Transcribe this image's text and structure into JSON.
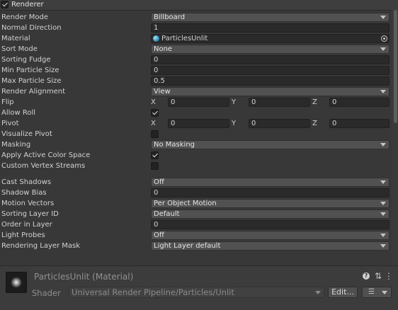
{
  "header": {
    "title": "Renderer",
    "enabled": true
  },
  "rows": {
    "render_mode": {
      "label": "Render Mode",
      "value": "Billboard"
    },
    "normal_direction": {
      "label": "Normal Direction",
      "value": "1"
    },
    "material": {
      "label": "Material",
      "value": "ParticlesUnlit"
    },
    "sort_mode": {
      "label": "Sort Mode",
      "value": "None"
    },
    "sorting_fudge": {
      "label": "Sorting Fudge",
      "value": "0"
    },
    "min_particle_size": {
      "label": "Min Particle Size",
      "value": "0"
    },
    "max_particle_size": {
      "label": "Max Particle Size",
      "value": "0.5"
    },
    "render_alignment": {
      "label": "Render Alignment",
      "value": "View"
    },
    "flip": {
      "label": "Flip",
      "x_label": "X",
      "x": "0",
      "y_label": "Y",
      "y": "0",
      "z_label": "Z",
      "z": "0"
    },
    "allow_roll": {
      "label": "Allow Roll",
      "checked": true
    },
    "pivot": {
      "label": "Pivot",
      "x_label": "X",
      "x": "0",
      "y_label": "Y",
      "y": "0",
      "z_label": "Z",
      "z": "0"
    },
    "visualize_pivot": {
      "label": "Visualize Pivot",
      "checked": false
    },
    "masking": {
      "label": "Masking",
      "value": "No Masking"
    },
    "apply_active_color_space": {
      "label": "Apply Active Color Space",
      "checked": true
    },
    "custom_vertex_streams": {
      "label": "Custom Vertex Streams",
      "checked": false
    },
    "cast_shadows": {
      "label": "Cast Shadows",
      "value": "Off"
    },
    "shadow_bias": {
      "label": "Shadow Bias",
      "value": "0"
    },
    "motion_vectors": {
      "label": "Motion Vectors",
      "value": "Per Object Motion"
    },
    "sorting_layer_id": {
      "label": "Sorting Layer ID",
      "value": "Default"
    },
    "order_in_layer": {
      "label": "Order in Layer",
      "value": "0"
    },
    "light_probes": {
      "label": "Light Probes",
      "value": "Off"
    },
    "rendering_layer_mask": {
      "label": "Rendering Layer Mask",
      "value": "Light Layer default"
    }
  },
  "material_panel": {
    "title": "ParticlesUnlit (Material)",
    "shader_label": "Shader",
    "shader_value": "Universal Render Pipeline/Particles/Unlit",
    "edit_label": "Edit...",
    "help_icon": "?",
    "settings_icon": "⇅",
    "menu_icon": "⋮",
    "list_icon": "☰"
  }
}
